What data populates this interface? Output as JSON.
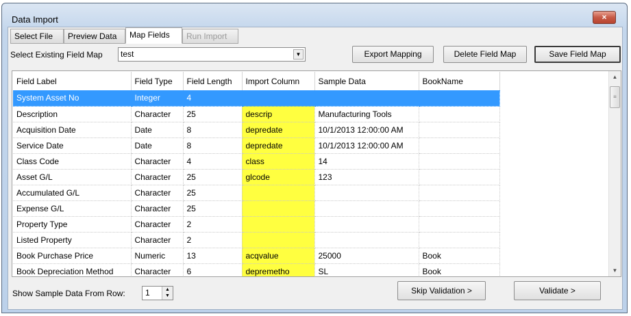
{
  "window": {
    "title": "Data Import",
    "close_icon": "×"
  },
  "tabs": [
    {
      "label": "Select File"
    },
    {
      "label": "Preview Data"
    },
    {
      "label": "Map Fields"
    },
    {
      "label": "Run Import"
    }
  ],
  "field_map": {
    "label": "Select Existing Field Map",
    "value": "test"
  },
  "buttons": {
    "export": "Export Mapping",
    "delete": "Delete Field Map",
    "save": "Save Field Map",
    "skip": "Skip Validation >",
    "validate": "Validate >"
  },
  "grid": {
    "columns": [
      "Field Label",
      "Field Type",
      "Field Length",
      "Import Column",
      "Sample Data",
      "BookName"
    ],
    "rows": [
      [
        "System Asset No",
        "Integer",
        "4",
        "",
        "",
        ""
      ],
      [
        "Description",
        "Character",
        "25",
        "descrip",
        "Manufacturing Tools",
        ""
      ],
      [
        "Acquisition Date",
        "Date",
        "8",
        "depredate",
        "10/1/2013 12:00:00 AM",
        ""
      ],
      [
        "Service Date",
        "Date",
        "8",
        "depredate",
        "10/1/2013 12:00:00 AM",
        ""
      ],
      [
        "Class Code",
        "Character",
        "4",
        "class",
        "14",
        ""
      ],
      [
        "Asset G/L",
        "Character",
        "25",
        "glcode",
        "123",
        ""
      ],
      [
        "Accumulated G/L",
        "Character",
        "25",
        "",
        "",
        ""
      ],
      [
        "Expense G/L",
        "Character",
        "25",
        "",
        "",
        ""
      ],
      [
        "Property Type",
        "Character",
        "2",
        "",
        "",
        ""
      ],
      [
        "Listed Property",
        "Character",
        "2",
        "",
        "",
        ""
      ],
      [
        "Book Purchase Price",
        "Numeric",
        "13",
        "acqvalue",
        "25000",
        "Book"
      ],
      [
        "Book Depreciation Method",
        "Character",
        "6",
        "depremetho",
        "SL",
        "Book"
      ]
    ]
  },
  "sample_row": {
    "label": "Show Sample Data From Row:",
    "value": "1"
  }
}
